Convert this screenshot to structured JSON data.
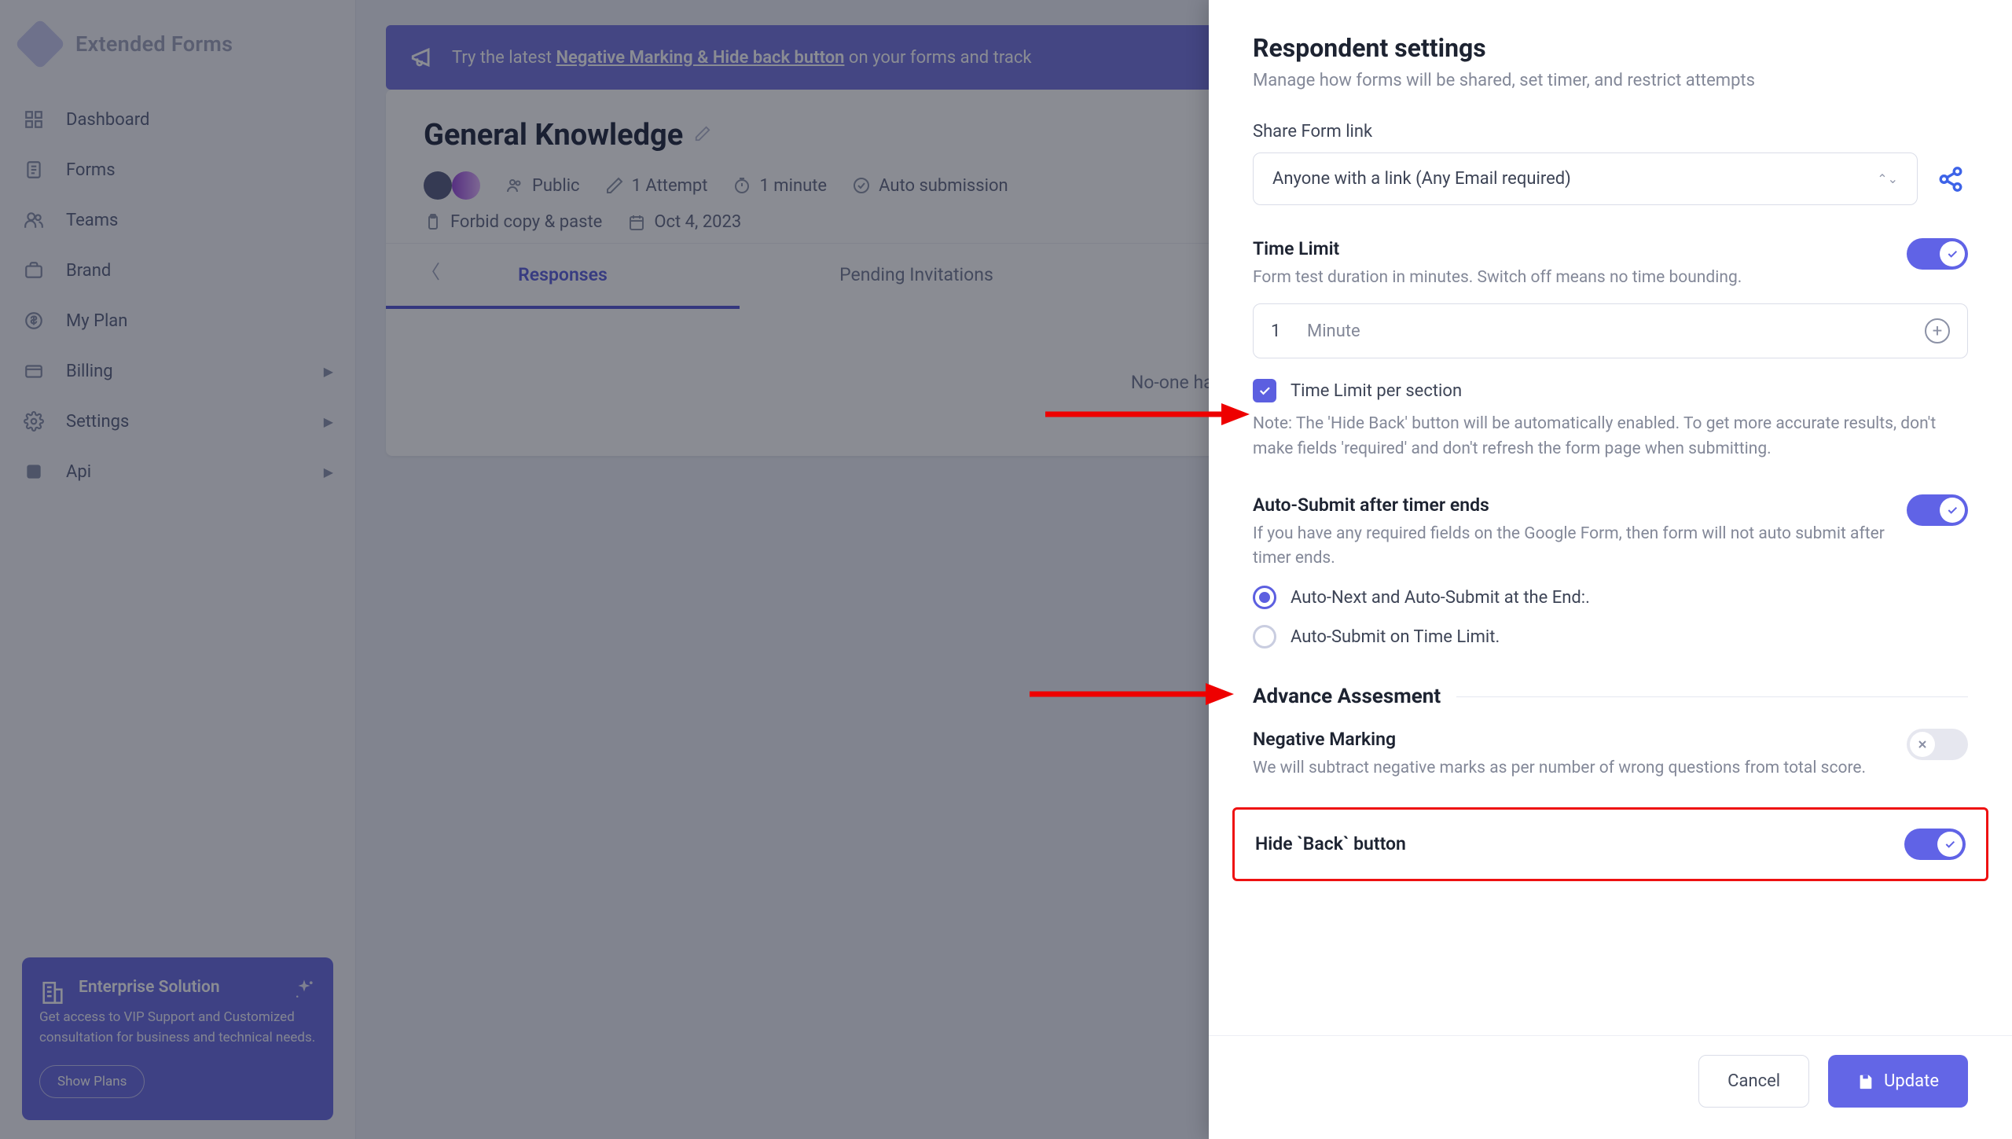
{
  "brand": "Extended Forms",
  "nav": {
    "dashboard": "Dashboard",
    "forms": "Forms",
    "teams": "Teams",
    "brand": "Brand",
    "myplan": "My Plan",
    "billing": "Billing",
    "settings": "Settings",
    "api": "Api"
  },
  "promo": {
    "title": "Enterprise Solution",
    "body": "Get access to VIP Support and Customized consultation for business and technical needs.",
    "cta": "Show Plans"
  },
  "banner": {
    "prefix": "Try the latest ",
    "link": "Negative Marking & Hide back button",
    "suffix": " on your forms and track"
  },
  "form": {
    "title": "General Knowledge",
    "visibility": "Public",
    "attempts": "1 Attempt",
    "duration": "1 minute",
    "autosubmit": "Auto submission",
    "forbid": "Forbid copy & paste",
    "date": "Oct 4, 2023"
  },
  "tabs": {
    "responses": "Responses",
    "pending": "Pending Invitations"
  },
  "empty": "No-one has g",
  "panel": {
    "title": "Respondent settings",
    "subtitle": "Manage how forms will be shared, set timer, and restrict attempts",
    "share": {
      "label": "Share Form link",
      "value": "Anyone with a link (Any Email required)"
    },
    "timelimit": {
      "label": "Time Limit",
      "help": "Form test duration in minutes. Switch off means no time bounding.",
      "value": "1",
      "unit": "Minute",
      "perSectionLabel": "Time Limit per section",
      "perSectionNote": "Note: The 'Hide Back' button will be automatically enabled. To get more accurate results, don't make fields 'required' and don't refresh the form page when submitting."
    },
    "autosubmit": {
      "label": "Auto-Submit after timer ends",
      "help": "If you have any required fields on the Google Form, then form will not auto submit after timer ends.",
      "opt1": "Auto-Next and Auto-Submit at the End:.",
      "opt2": "Auto-Submit on Time Limit."
    },
    "adv": {
      "title": "Advance Assesment"
    },
    "negmark": {
      "label": "Negative Marking",
      "help": "We will subtract negative marks as per number of wrong questions from total score."
    },
    "hideback": {
      "label": "Hide `Back` button"
    },
    "cancel": "Cancel",
    "update": "Update"
  }
}
